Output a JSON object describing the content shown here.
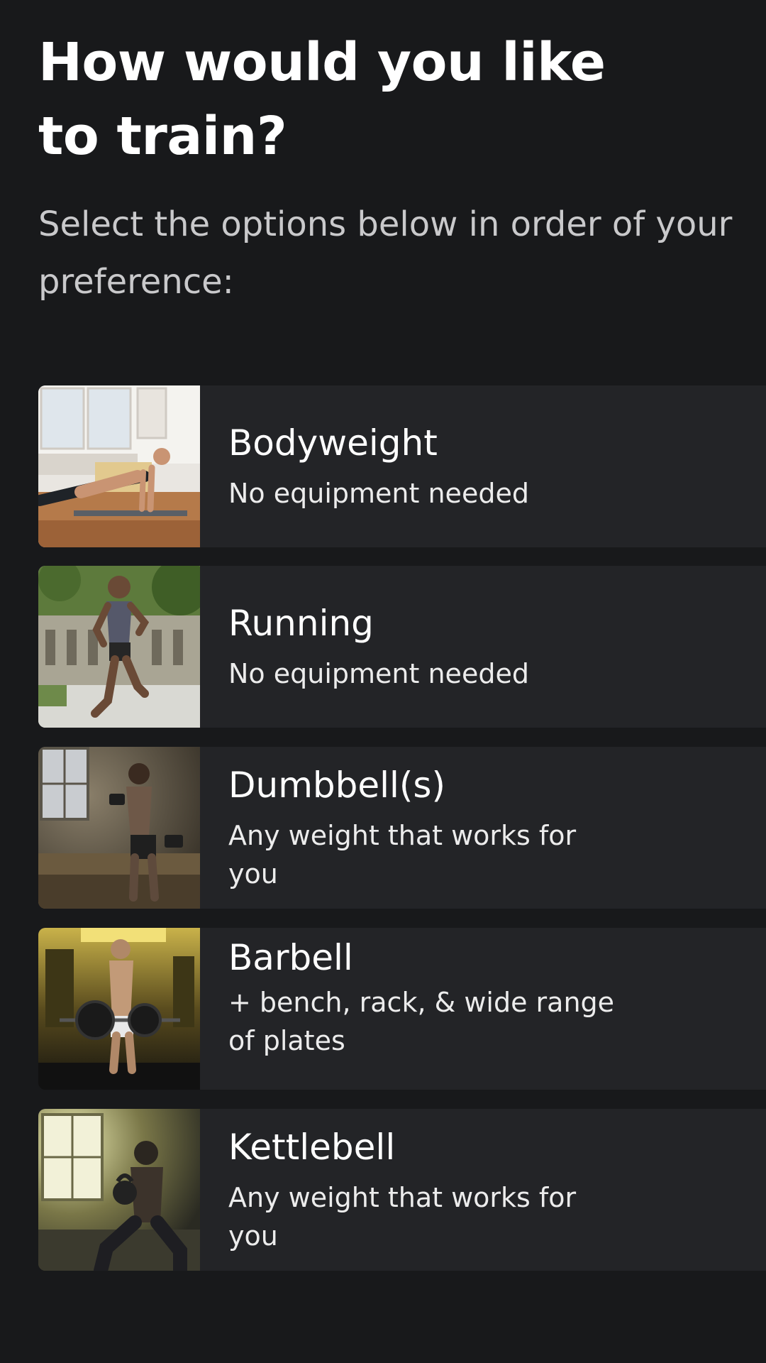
{
  "header": {
    "title": "How would you like to train?",
    "subtitle": "Select the options below in order of your preference:"
  },
  "options": [
    {
      "title": "Bodyweight",
      "description": "No equipment needed",
      "image_icon": "person-pushup-photo"
    },
    {
      "title": "Running",
      "description": "No equipment needed",
      "image_icon": "person-running-photo"
    },
    {
      "title": "Dumbbell(s)",
      "description": "Any weight that works for you",
      "image_icon": "person-dumbbell-curl-photo"
    },
    {
      "title": "Barbell",
      "description": "+ bench, rack, & wide range of plates",
      "image_icon": "person-barbell-deadlift-photo"
    },
    {
      "title": "Kettlebell",
      "description": "Any weight that works for you",
      "image_icon": "person-kettlebell-lunge-photo"
    }
  ],
  "colors": {
    "background": "#18191b",
    "card": "#232427",
    "text_primary": "#ffffff",
    "text_secondary": "#c9c9cb"
  }
}
